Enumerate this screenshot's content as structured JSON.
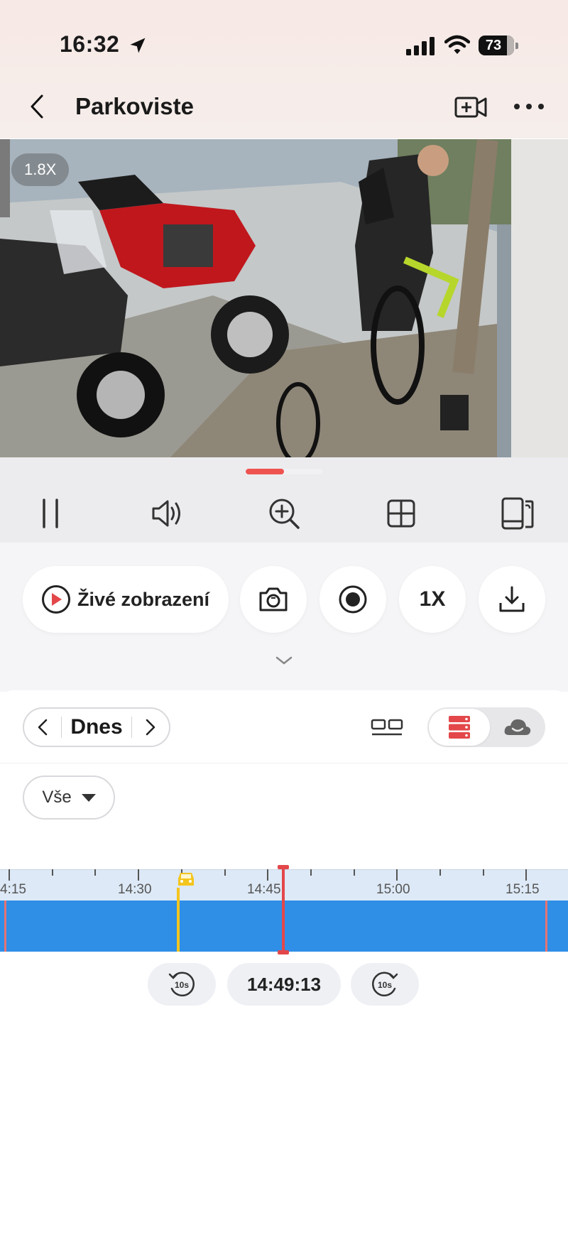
{
  "status_bar": {
    "time": "16:32",
    "battery": "73"
  },
  "header": {
    "title": "Parkoviste"
  },
  "video": {
    "zoom": "1.8X",
    "scene": "security camera feed: motorcycles and a man with a bicycle under a parking canopy"
  },
  "controls": [
    "pause-icon",
    "volume-icon",
    "zoom-in-icon",
    "grid-icon",
    "rotate-screen-icon"
  ],
  "actions": {
    "live_label": "Živé zobrazení",
    "speed_label": "1X"
  },
  "panel": {
    "date_label": "Dnes",
    "filter_label": "Vše"
  },
  "timeline": {
    "labels": [
      "4:15",
      "14:30",
      "14:45",
      "15:00",
      "15:15"
    ],
    "current_time": "14:49:13",
    "seek_back": "10s",
    "seek_forward": "10s"
  },
  "colors": {
    "accent": "#e3474a",
    "track": "#2f8ee6",
    "event": "#f3c51e"
  }
}
